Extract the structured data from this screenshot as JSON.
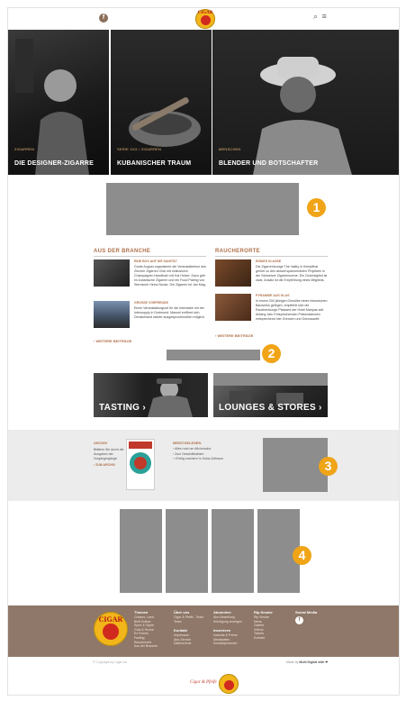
{
  "header": {
    "icons": {
      "facebook": "f",
      "search": "⌕",
      "menu": "≡"
    },
    "logo_text": "CIGAR"
  },
  "hero": [
    {
      "category": "ZIGARREN",
      "title": "DIE DESIGNER-ZIGARRE"
    },
    {
      "category": "SERIE XXX / ZIGARREN",
      "title": "KUBANISCHER TRAUM"
    },
    {
      "category": "MENSCHEN",
      "title": "BLENDER UND BOTSCHAFTER"
    }
  ],
  "badges": [
    "1",
    "2",
    "3",
    "4"
  ],
  "branche": {
    "heading": "AUS DER BRANCHE",
    "items": [
      {
        "title": "EINE BOX AUF DIE SANITÄT",
        "text": "Guide August organisierte die Veranstalterbox des Zürcher Zigarren Club mit exklusivem Champagner-Handbuch mit Kai Holzer. Dazu gibt es kubanische Zigarren und ein Food Pairing von Sternkoch Heinz Nocke. Die Zigarren ist Jan Mag,"
      },
      {
        "title": "GROSSE VORFREUDE",
        "text": "Einen Veranstaltungsort für die Interstake mit der Intersupply in Dortmund. Manuel eröffnet sich Deutschland wieder ausgesprochendlich möglich."
      }
    ],
    "more": "› WEITERE BEITRÄGE"
  },
  "raucherorte": {
    "heading": "RAUCHERORTE",
    "items": [
      {
        "title": "EDDIES KLASSE",
        "text": "Die Zigarrenlounge The Valley in Kempfthal gehört zu den aktuell spannendsten Projekten in der Schweizer Zigarrenszene. Ein Clubmitglied ist zwar, Ansatz ist die Empfehlung eines Mitglieds."
      },
      {
        "title": "PYRAMIDE AUS GLAS",
        "text": "In einem 200 jährigen Gewölbe eines historischen Bauwerks gelegen, empfiehlt sich die Raucherlounge Pfalzamt der Hotel Maripas seit Anfang Jahr Entsprechenden Präsentationen entsprechend hier Grenzen und Genusswelt."
      }
    ],
    "more": "› WEITERE BEITRÄGE"
  },
  "tiles": [
    {
      "label": "TASTING ›"
    },
    {
      "label": "LOUNGES & STORES ›"
    }
  ],
  "archiv": {
    "heading": "ARCHIV",
    "text": "Blättern Sie durch die Ausgaben der Vorgängergänge",
    "link": "› ZUM ARCHIV"
  },
  "meistgelesen": {
    "heading": "MEISTGELESEN",
    "items": [
      "› Alles rund um Aficionados",
      "› Zum Geschäftsleben",
      "› «Fertig machen» in Kuba-Zeitraum"
    ]
  },
  "footer": {
    "columns": [
      {
        "heading": "Themen",
        "items": [
          "Cubans, Land",
          "Bluff Hollow",
          "Sport & Tipple",
          "Gold & Sonne",
          "Ex Forces",
          "Fasting",
          "Raucherorte",
          "Aus der Branche"
        ]
      },
      {
        "heading": "Über uns",
        "items": [
          "Cigar & Pfeife - Team",
          "Team"
        ]
      },
      {
        "heading": "Abonniere",
        "items": [
          "Abo-Bestellung",
          "Kündigung anzeigen"
        ]
      },
      {
        "heading": "Rip Smoke",
        "items": [
          "Rip Smoke",
          "News",
          "Galerie",
          "Videos",
          "Tickets",
          "Kontakt"
        ]
      },
      {
        "heading": "Social Media",
        "items": []
      }
    ],
    "sub_columns": [
      {
        "heading": "Kontakt",
        "items": [
          "Impressum",
          "Abo-Service",
          "Datenschutz"
        ]
      },
      {
        "heading": "Inserieren",
        "items": [
          "Inserate & Preise",
          "Mediadaten",
          "Kontaktpersonen"
        ]
      }
    ],
    "facebook": "f"
  },
  "bottom": {
    "copyright": "© Copyright by Cigar Inc",
    "made_by": "Made by",
    "made_by_company": "Multi Digital with ❤",
    "signature": "Cigar & Pfeife"
  },
  "colors": {
    "accent": "#b0714a",
    "badge": "#f0a417",
    "footer": "#8f7869",
    "ad": "#8d8d8d"
  }
}
